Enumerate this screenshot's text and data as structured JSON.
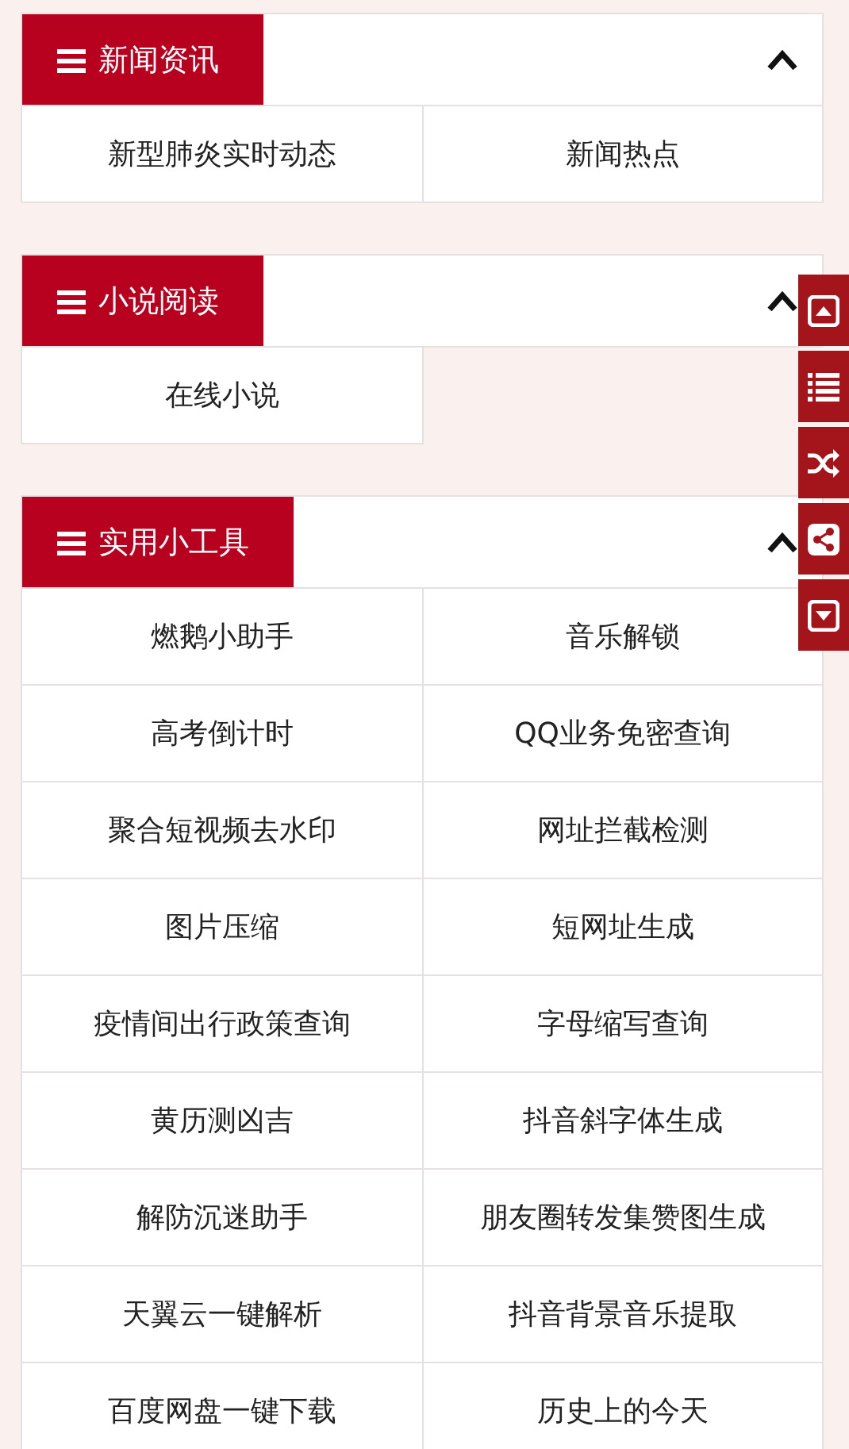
{
  "sections": [
    {
      "title": "新闻资讯",
      "expanded": true,
      "items": [
        "新型肺炎实时动态",
        "新闻热点"
      ]
    },
    {
      "title": "小说阅读",
      "expanded": true,
      "items": [
        "在线小说"
      ]
    },
    {
      "title": "实用小工具",
      "expanded": true,
      "items": [
        "燃鹅小助手",
        "音乐解锁",
        "高考倒计时",
        "QQ业务免密查询",
        "聚合短视频去水印",
        "网址拦截检测",
        "图片压缩",
        "短网址生成",
        "疫情间出行政策查询",
        "字母缩写查询",
        "黄历测凶吉",
        "抖音斜字体生成",
        "解防沉迷助手",
        "朋友圈转发集赞图生成",
        "天翼云一键解析",
        "抖音背景音乐提取",
        "百度网盘一键下载",
        "历史上的今天"
      ]
    }
  ],
  "side_bar": [
    {
      "kind": "top"
    },
    {
      "kind": "list"
    },
    {
      "kind": "random"
    },
    {
      "kind": "share"
    },
    {
      "kind": "bottom"
    }
  ]
}
